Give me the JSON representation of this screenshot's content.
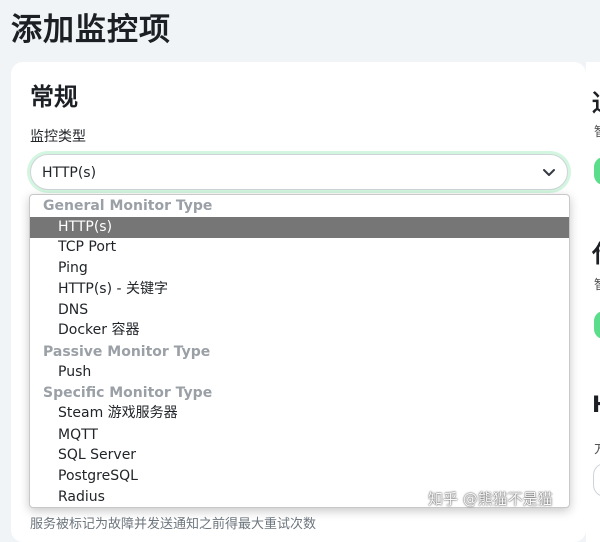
{
  "page": {
    "title": "添加监控项"
  },
  "general": {
    "section_title": "常规",
    "monitor_type_label": "监控类型",
    "selected_value": "HTTP(s)"
  },
  "dropdown": {
    "groups": [
      {
        "label": "General Monitor Type",
        "items": [
          "HTTP(s)",
          "TCP Port",
          "Ping",
          "HTTP(s) - 关键字",
          "DNS",
          "Docker 容器"
        ]
      },
      {
        "label": "Passive Monitor Type",
        "items": [
          "Push"
        ]
      },
      {
        "label": "Specific Monitor Type",
        "items": [
          "Steam 游戏服务器",
          "MQTT",
          "SQL Server",
          "PostgreSQL",
          "Radius"
        ]
      }
    ],
    "highlighted": "HTTP(s)"
  },
  "right_edge": {
    "heading_1": "通",
    "text_1": "智",
    "heading_2": "代",
    "text_2": "智",
    "heading_3": "H",
    "text_3": "方"
  },
  "bottom_hint": "服务被标记为故障并发送通知之前得最大重试次数",
  "watermark": "知乎 @熊猫不是猫",
  "colors": {
    "accent": "#5cdd8b",
    "highlight": "#767676"
  },
  "icons": {
    "select_chevron": "chevron-down-icon"
  }
}
